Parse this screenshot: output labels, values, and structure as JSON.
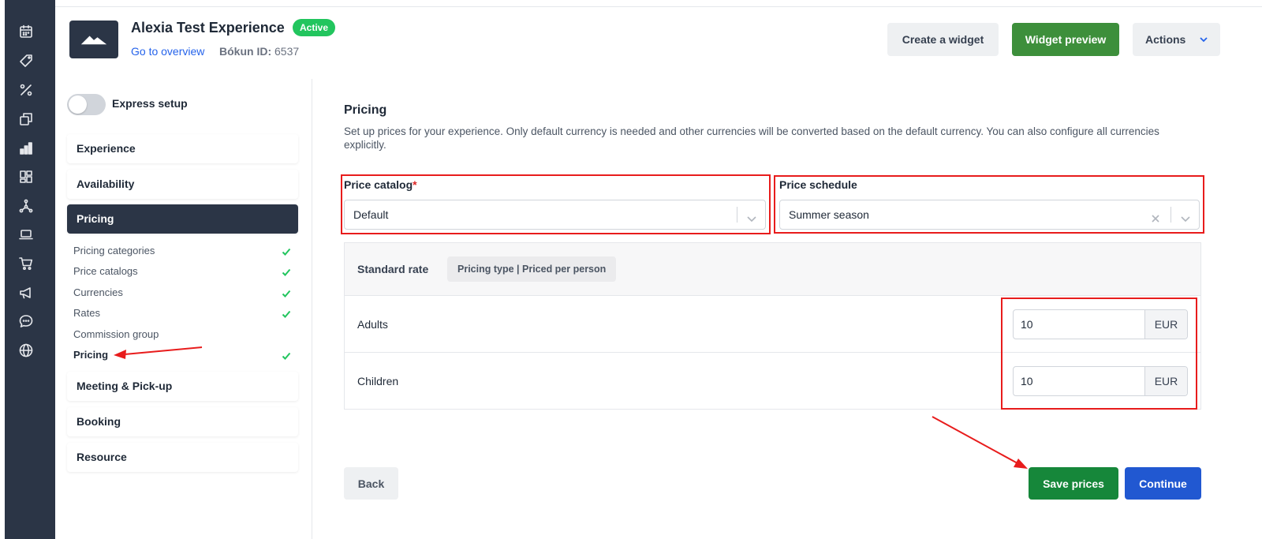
{
  "rail": {
    "icons": [
      "calendar-icon",
      "tag-icon",
      "percent-icon",
      "copy-icon",
      "bar-chart-icon",
      "dashboard-icon",
      "network-icon",
      "laptop-icon",
      "cart-icon",
      "megaphone-icon",
      "chat-icon",
      "globe-icon"
    ]
  },
  "header": {
    "title": "Alexia Test Experience",
    "status_badge": "Active",
    "overview_link": "Go to overview",
    "bokun_id_label": "Bókun ID:",
    "bokun_id_value": "6537",
    "create_widget": "Create a widget",
    "widget_preview": "Widget preview",
    "actions": "Actions"
  },
  "sidebar": {
    "express_setup": "Express setup",
    "express_setup_on": false,
    "sections": [
      {
        "label": "Experience"
      },
      {
        "label": "Availability"
      },
      {
        "label": "Pricing",
        "active": true
      },
      {
        "label": "Meeting & Pick-up"
      },
      {
        "label": "Booking"
      },
      {
        "label": "Resource"
      }
    ],
    "pricing_subitems": [
      {
        "label": "Pricing categories",
        "done": true
      },
      {
        "label": "Price catalogs",
        "done": true
      },
      {
        "label": "Currencies",
        "done": true
      },
      {
        "label": "Rates",
        "done": true
      },
      {
        "label": "Commission group",
        "done": false
      },
      {
        "label": "Pricing",
        "done": true,
        "current": true
      }
    ]
  },
  "main": {
    "title": "Pricing",
    "description": "Set up prices for your experience. Only default currency is needed and other currencies will be converted based on the default currency. You can also configure all currencies explicitly.",
    "price_catalog_label": "Price catalog",
    "price_catalog_required": "*",
    "price_catalog_value": "Default",
    "price_schedule_label": "Price schedule",
    "price_schedule_value": "Summer season",
    "rate_name": "Standard rate",
    "pricing_type": "Pricing type | Priced per person",
    "rows": [
      {
        "label": "Adults",
        "price": "10",
        "currency": "EUR"
      },
      {
        "label": "Children",
        "price": "10",
        "currency": "EUR"
      }
    ],
    "back": "Back",
    "save_prices": "Save prices",
    "continue": "Continue"
  },
  "colors": {
    "rail_bg": "#2b3546",
    "active_badge": "#22c55e",
    "widget_preview_bg": "#3d8f3b",
    "save_bg": "#16873a",
    "continue_bg": "#2158d1",
    "annotation_red": "#e81c1c"
  }
}
